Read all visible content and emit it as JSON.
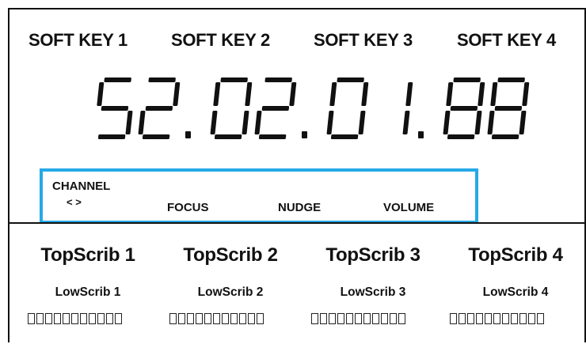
{
  "soft_keys": [
    "SOFT KEY 1",
    "SOFT KEY 2",
    "SOFT KEY 3",
    "SOFT KEY 4"
  ],
  "display": {
    "digits": [
      "5",
      "2",
      "0",
      "2",
      "0",
      "1",
      "8",
      "8"
    ],
    "text": "52.02.01.88"
  },
  "functions": {
    "channel_line1": "CHANNEL",
    "channel_line2": "< >",
    "focus": "FOCUS",
    "nudge": "NUDGE",
    "volume": "VOLUME",
    "highlight_color": "#25a9e6"
  },
  "tracks": [
    {
      "top": "TopScrib 1",
      "low": "LowScrib 1"
    },
    {
      "top": "TopScrib 2",
      "low": "LowScrib 2"
    },
    {
      "top": "TopScrib 3",
      "low": "LowScrib 3"
    },
    {
      "top": "TopScrib 4",
      "low": "LowScrib 4"
    }
  ],
  "cells_per_track": 11
}
